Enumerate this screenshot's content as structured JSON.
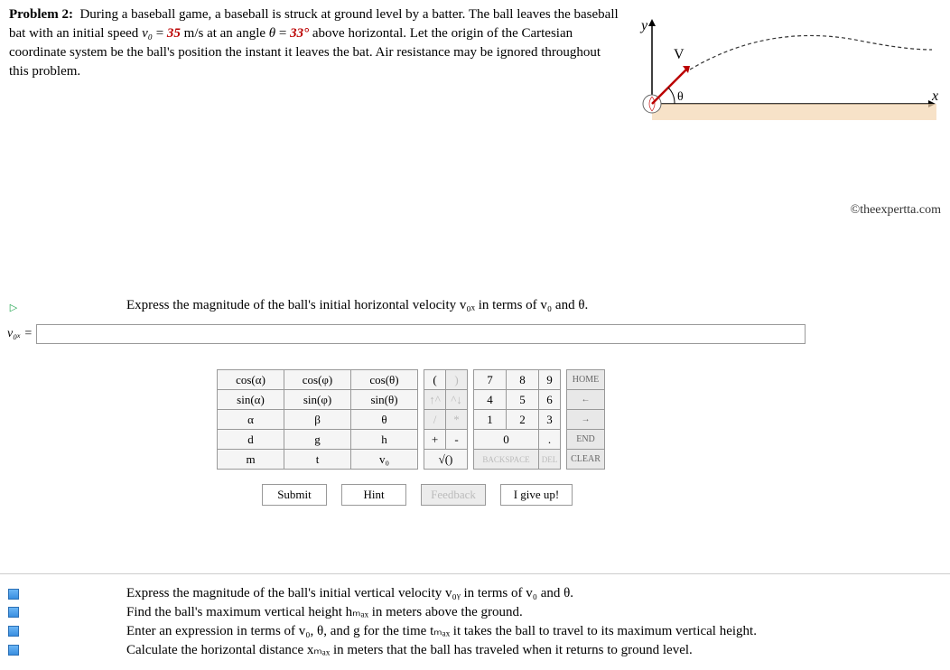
{
  "problem": {
    "title": "Problem 2:",
    "text1": "During a baseball game, a baseball is struck at ground level by a batter. The ball leaves the baseball bat with an initial speed ",
    "v0": "v₀",
    "eq1": " = ",
    "val1": "35",
    "unit1": " m/s at an angle ",
    "theta": "θ",
    "eq2": " = ",
    "val2": "33°",
    "text2": " above horizontal. Let the origin of the Cartesian coordinate system be the ball's position the instant it leaves the bat. Air resistance may be ignored throughout this problem."
  },
  "diagram": {
    "y_label": "y",
    "x_label": "x",
    "v_label": "V",
    "theta_label": "θ"
  },
  "copyright": "©theexpertta.com",
  "part": {
    "prompt": "Express the magnitude of the ball's initial horizontal velocity v₀ₓ in terms of v₀ and θ.",
    "var_label": "v₀ₓ ="
  },
  "keypad": {
    "fn": [
      [
        "cos(α)",
        "cos(φ)",
        "cos(θ)"
      ],
      [
        "sin(α)",
        "sin(φ)",
        "sin(θ)"
      ],
      [
        "α",
        "β",
        "θ"
      ],
      [
        "d",
        "g",
        "h"
      ],
      [
        "m",
        "t",
        "v₀"
      ]
    ],
    "sym": [
      [
        "(",
        ")"
      ],
      [
        "↑^",
        "^↓"
      ],
      [
        "/",
        "*"
      ],
      [
        "+",
        "-"
      ],
      [
        "√()",
        ""
      ]
    ],
    "num": [
      [
        "7",
        "8",
        "9"
      ],
      [
        "4",
        "5",
        "6"
      ],
      [
        "1",
        "2",
        "3"
      ],
      [
        "0",
        "."
      ],
      [
        "BACKSPACE",
        "DEL"
      ]
    ],
    "nav": [
      "HOME",
      "←",
      "→",
      "END",
      "CLEAR"
    ]
  },
  "actions": {
    "submit": "Submit",
    "hint": "Hint",
    "feedback": "Feedback",
    "giveup": "I give up!"
  },
  "subs": [
    "Express the magnitude of the ball's initial vertical velocity v₀ᵧ in terms of v₀ and θ.",
    "Find the ball's maximum vertical height hₘₐₓ in meters above the ground.",
    "Enter an expression in terms of v₀, θ, and g for the time tₘₐₓ it takes the ball to travel to its maximum vertical height.",
    "Calculate the horizontal distance xₘₐₓ in meters that the ball has traveled when it returns to ground level."
  ]
}
